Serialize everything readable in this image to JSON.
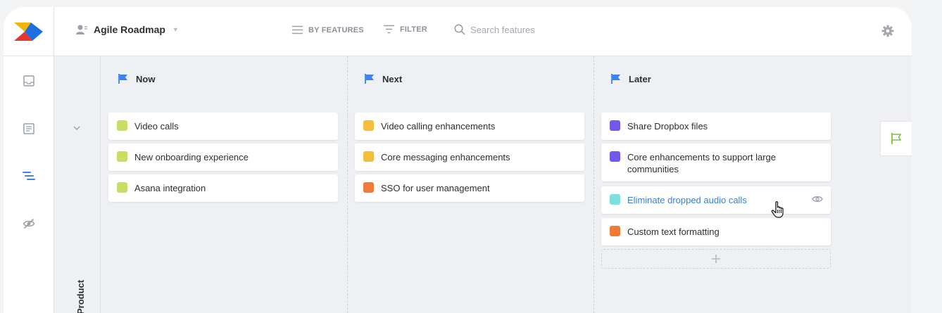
{
  "header": {
    "roadmap_name": "Agile Roadmap",
    "group_by_label": "BY FEATURES",
    "filter_label": "FILTER",
    "search_placeholder": "Search features"
  },
  "sidebar": {
    "items": [
      {
        "icon": "inbox-icon"
      },
      {
        "icon": "document-icon"
      },
      {
        "icon": "roadmap-icon",
        "active": true
      },
      {
        "icon": "hidden-icon"
      }
    ]
  },
  "group": {
    "label": "Product"
  },
  "columns": [
    {
      "title": "Now",
      "cards": [
        {
          "text": "Video calls",
          "color": "#c5e063"
        },
        {
          "text": "New onboarding experience",
          "color": "#c5e063"
        },
        {
          "text": "Asana integration",
          "color": "#c5e063"
        }
      ]
    },
    {
      "title": "Next",
      "cards": [
        {
          "text": "Video calling enhancements",
          "color": "#f3bf3a"
        },
        {
          "text": "Core messaging enhancements",
          "color": "#f3bf3a"
        },
        {
          "text": "SSO for user management",
          "color": "#ef7b35"
        }
      ]
    },
    {
      "title": "Later",
      "cards": [
        {
          "text": "Share Dropbox files",
          "color": "#7357f0"
        },
        {
          "text": "Core enhancements to support large communities",
          "color": "#7357f0"
        },
        {
          "text": "Eliminate dropped audio calls",
          "color": "#7cdfe0",
          "hovered": true
        },
        {
          "text": "Custom text formatting",
          "color": "#ef7b35"
        }
      ]
    }
  ],
  "colors": {
    "flag_blue": "#3b82f6",
    "flag_green": "#7cc23a",
    "link_blue": "#3c7fd2"
  }
}
